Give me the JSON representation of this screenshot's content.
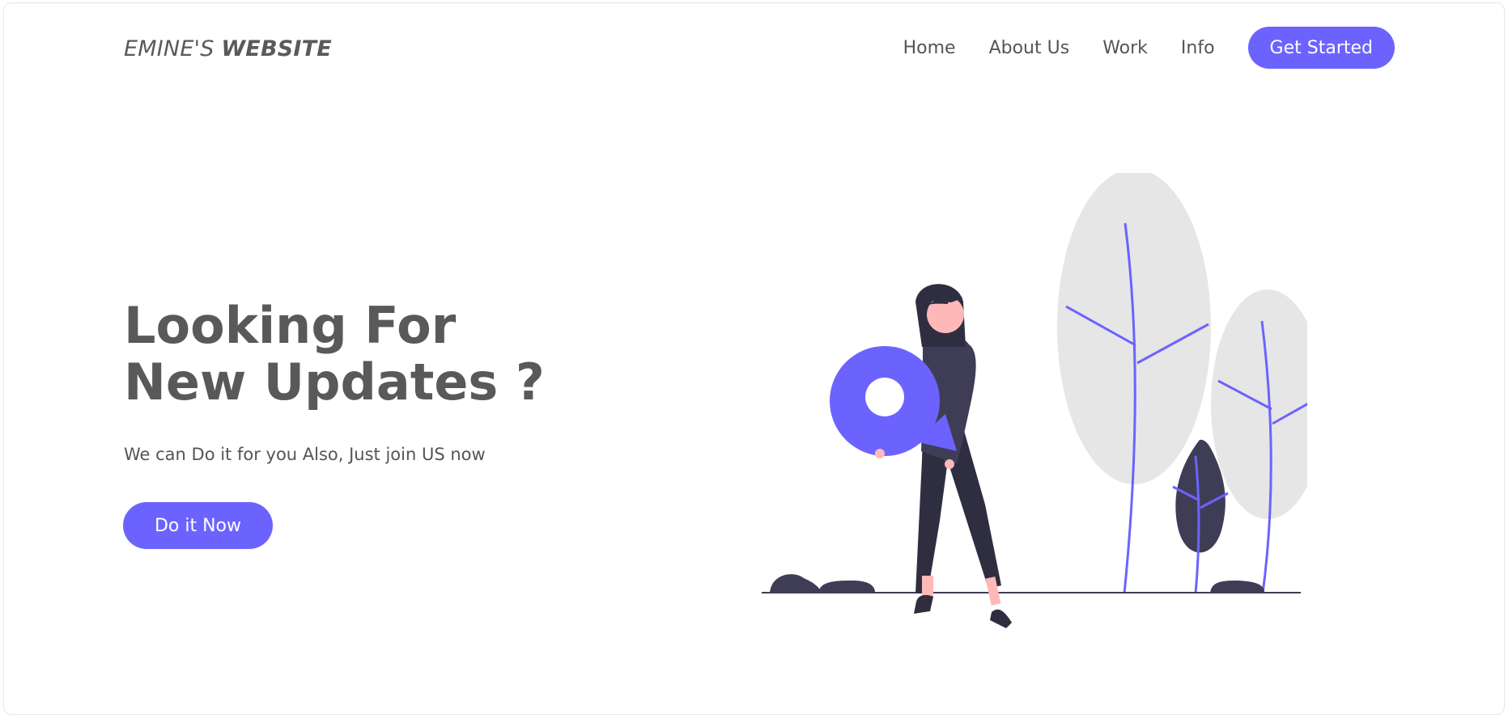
{
  "header": {
    "logo_prefix": "EMINE'S ",
    "logo_bold": "WEBSITE",
    "nav": [
      "Home",
      "About Us",
      "Work",
      "Info"
    ],
    "cta": "Get Started"
  },
  "hero": {
    "title": "Looking For\nNew Updates ?",
    "subtitle": "We can Do it for you Also, Just join US now",
    "button": "Do it Now"
  },
  "colors": {
    "accent": "#6c63ff",
    "dark": "#3f3d56",
    "text": "#555555",
    "foliage": "#e6e6e6",
    "skin": "#ffb8b8"
  },
  "illustration": {
    "subject": "woman holding location pin beside trees",
    "icons": [
      "location-pin-icon",
      "tree-icon",
      "bush-icon",
      "rock-icon"
    ]
  }
}
